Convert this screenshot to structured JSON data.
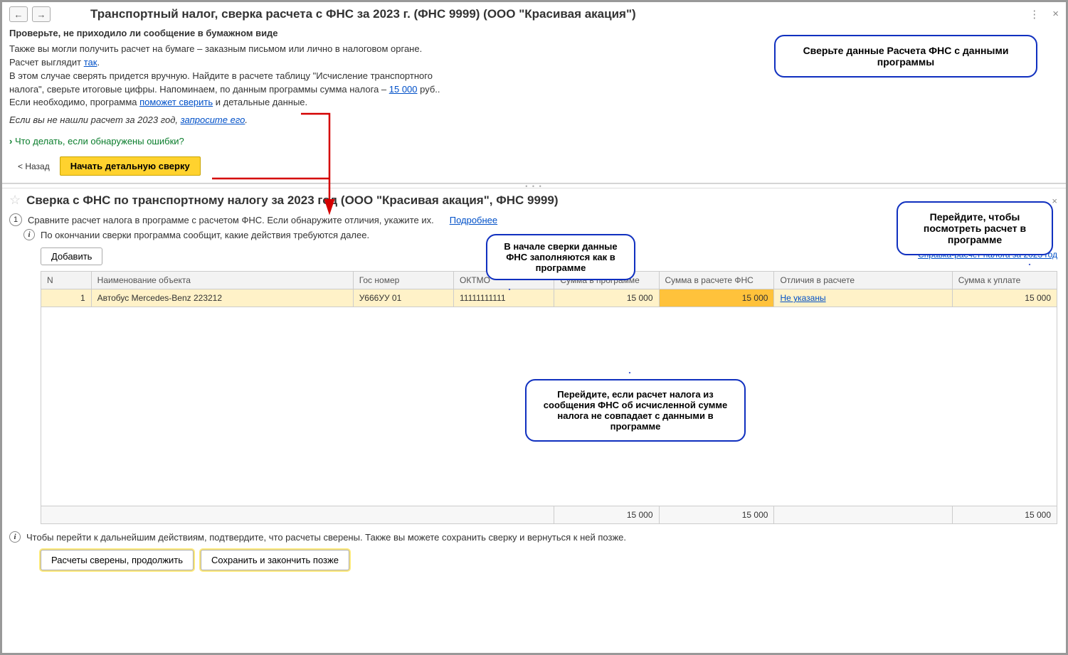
{
  "top": {
    "title": "Транспортный налог, сверка расчета с ФНС за 2023 г. (ФНС 9999) (ООО \"Красивая акация\")",
    "subheading": "Проверьте, не приходило ли сообщение в бумажном виде",
    "p1a": "Также вы могли получить расчет на бумаге – заказным письмом или лично в налоговом органе.",
    "p1b_prefix": "Расчет выглядит ",
    "p1b_link": "так",
    "p1b_suffix": ".",
    "p2a": "В этом случае сверять придется вручную. Найдите в расчете таблицу \"Исчисление транспортного налога\", сверьте итоговые цифры. Напоминаем, по данным программы сумма налога – ",
    "p2_link": "15 000",
    "p2b": " руб..",
    "p3a": "Если необходимо, программа ",
    "p3_link": "поможет сверить",
    "p3b": " и детальные данные.",
    "italic_a": "Если вы не нашли расчет за 2023 год, ",
    "italic_link": "запросите его",
    "italic_b": ".",
    "expander": "Что делать, если обнаружены ошибки?",
    "back": "< Назад",
    "start_detail": "Начать детальную сверку"
  },
  "bottom": {
    "title": "Сверка с ФНС по транспортному налогу за 2023 год (ООО \"Красивая акация\", ФНС 9999)",
    "step_num": "1",
    "step_text": "Сравните расчет налога в программе с расчетом ФНС. Если обнаружите отличия, укажите их.",
    "more": "Подробнее",
    "info_text": "По окончании сверки программа сообщит, какие действия требуются далее.",
    "add": "Добавить",
    "right_link": "Справка-расчет налога за 2023 год",
    "columns": {
      "n": "N",
      "name": "Наименование объекта",
      "gos": "Гос номер",
      "oktmo": "ОКТМО",
      "sum_prog": "Сумма в программе",
      "sum_fns": "Сумма в расчете ФНС",
      "diff": "Отличия в расчете",
      "pay": "Сумма к уплате"
    },
    "rows": [
      {
        "n": "1",
        "name": "Автобус Mercedes-Benz 223212",
        "gos": "У666УУ 01",
        "oktmo": "11111111111",
        "sum_prog": "15 000",
        "sum_fns": "15 000",
        "diff": "Не указаны",
        "pay": "15 000"
      }
    ],
    "totals": {
      "sum_prog": "15 000",
      "sum_fns": "15 000",
      "pay": "15 000"
    },
    "footer_info": "Чтобы перейти к дальнейшим действиям, подтвердите, что расчеты сверены. Также вы можете сохранить сверку и вернуться к ней позже.",
    "btn_continue": "Расчеты сверены, продолжить",
    "btn_save": "Сохранить и закончить позже"
  },
  "callouts": {
    "c1": "Сверьте данные Расчета ФНС с данными программы",
    "c2": "Перейдите, чтобы посмотреть расчет в программе",
    "c3": "В начале сверки данные ФНС заполняются как в программе",
    "c4": "Перейдите, если расчет налога из сообщения ФНС об исчисленной сумме налога не совпадает с данными в программе"
  }
}
